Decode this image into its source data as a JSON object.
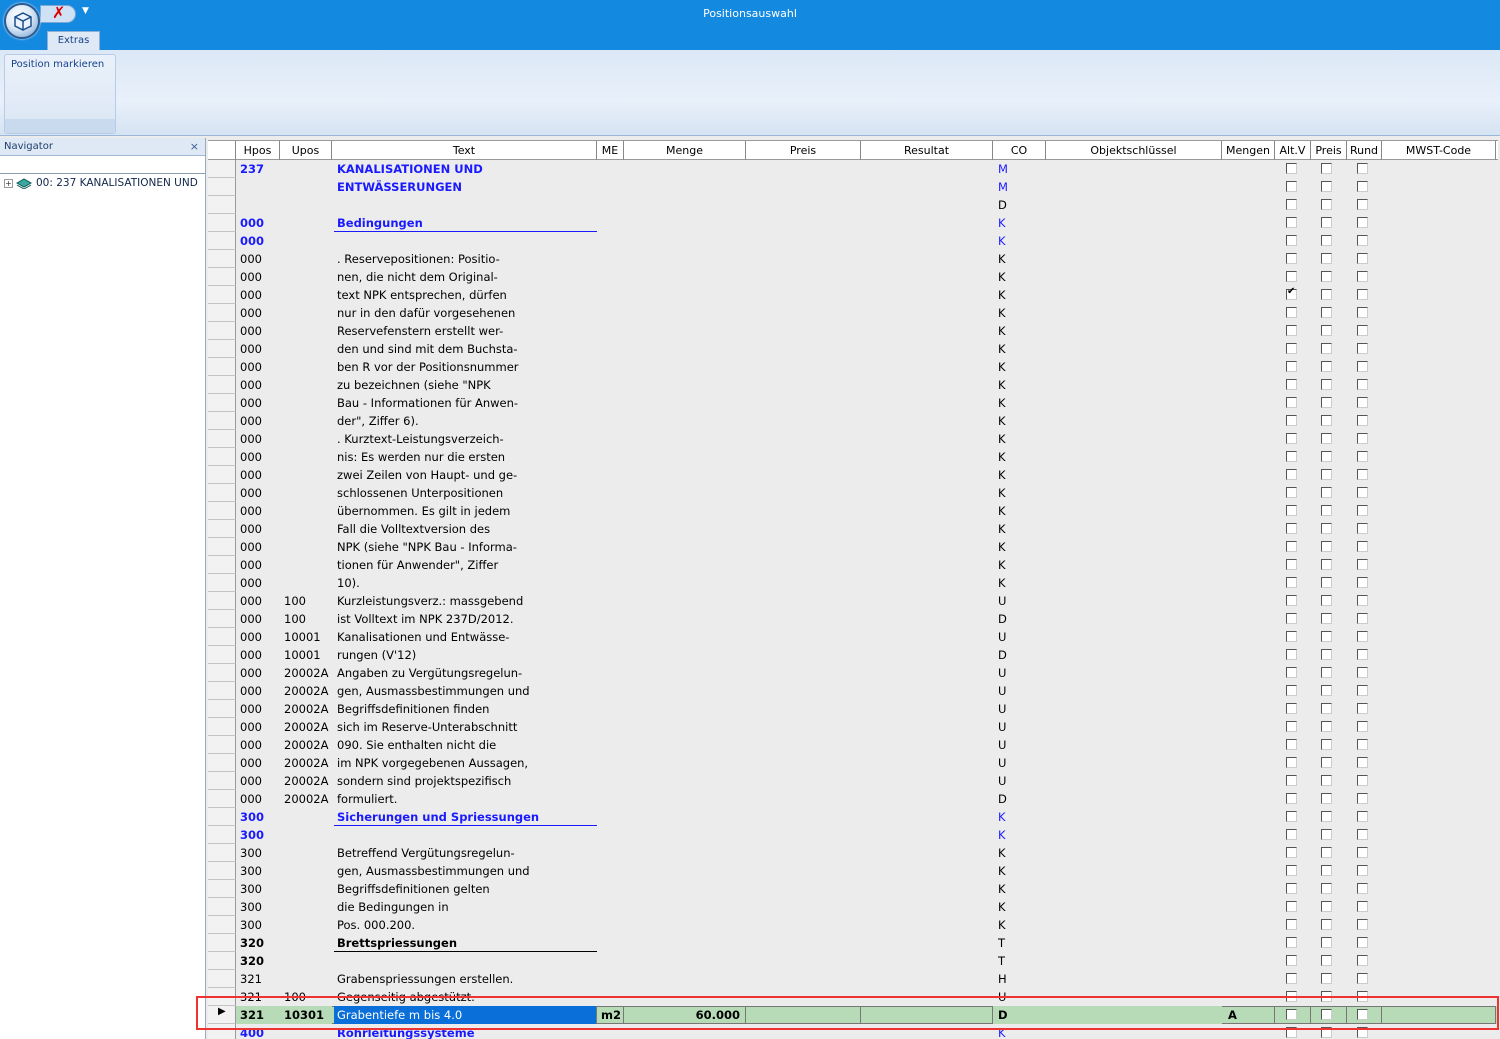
{
  "window": {
    "title": "Positionsauswahl"
  },
  "ribbon": {
    "tab": "Extras",
    "button": "Position markieren"
  },
  "navigator": {
    "title": "Navigator",
    "close": "×",
    "search_value": "",
    "tree_item": "00: 237 KANALISATIONEN UND"
  },
  "grid": {
    "columns": [
      "Hpos",
      "Upos",
      "Text",
      "ME",
      "Menge",
      "Preis",
      "Resultat",
      "CO",
      "Objektschlüssel",
      "Mengen",
      "Alt.V",
      "Preis",
      "Rund",
      "MWST-Code"
    ],
    "rows": [
      {
        "hpos": "237",
        "upos": "",
        "text": "KANALISATIONEN UND",
        "co": "M",
        "style": "h1",
        "alt": false
      },
      {
        "hpos": "",
        "upos": "",
        "text": "ENTWÄSSERUNGEN",
        "co": "M",
        "style": "h1",
        "alt": false
      },
      {
        "hpos": "",
        "upos": "",
        "text": "",
        "co": "D",
        "style": "n",
        "alt": false
      },
      {
        "hpos": "000",
        "upos": "",
        "text": "Bedingungen",
        "co": "K",
        "style": "h1u",
        "alt": false
      },
      {
        "hpos": "000",
        "upos": "",
        "text": "",
        "co": "K",
        "style": "hb",
        "alt": false
      },
      {
        "hpos": "000",
        "upos": "",
        "text": ". Reservepositionen: Positio-",
        "co": "K",
        "style": "n",
        "alt": false
      },
      {
        "hpos": "000",
        "upos": "",
        "text": "nen, die nicht dem Original-",
        "co": "K",
        "style": "n",
        "alt": false
      },
      {
        "hpos": "000",
        "upos": "",
        "text": "text NPK entsprechen, dürfen",
        "co": "K",
        "style": "n",
        "alt": true
      },
      {
        "hpos": "000",
        "upos": "",
        "text": "nur in den dafür vorgesehenen",
        "co": "K",
        "style": "n",
        "alt": false
      },
      {
        "hpos": "000",
        "upos": "",
        "text": "Reservefenstern erstellt wer-",
        "co": "K",
        "style": "n",
        "alt": false
      },
      {
        "hpos": "000",
        "upos": "",
        "text": "den und sind mit dem Buchsta-",
        "co": "K",
        "style": "n",
        "alt": false
      },
      {
        "hpos": "000",
        "upos": "",
        "text": "ben R vor der Positionsnummer",
        "co": "K",
        "style": "n",
        "alt": false
      },
      {
        "hpos": "000",
        "upos": "",
        "text": "zu bezeichnen (siehe \"NPK",
        "co": "K",
        "style": "n",
        "alt": false
      },
      {
        "hpos": "000",
        "upos": "",
        "text": "Bau - Informationen für Anwen-",
        "co": "K",
        "style": "n",
        "alt": false
      },
      {
        "hpos": "000",
        "upos": "",
        "text": "der\", Ziffer 6).",
        "co": "K",
        "style": "n",
        "alt": false
      },
      {
        "hpos": "000",
        "upos": "",
        "text": ". Kurztext-Leistungsverzeich-",
        "co": "K",
        "style": "n",
        "alt": false
      },
      {
        "hpos": "000",
        "upos": "",
        "text": "nis: Es werden nur die ersten",
        "co": "K",
        "style": "n",
        "alt": false
      },
      {
        "hpos": "000",
        "upos": "",
        "text": "zwei Zeilen von Haupt- und ge-",
        "co": "K",
        "style": "n",
        "alt": false
      },
      {
        "hpos": "000",
        "upos": "",
        "text": "schlossenen Unterpositionen",
        "co": "K",
        "style": "n",
        "alt": false
      },
      {
        "hpos": "000",
        "upos": "",
        "text": "übernommen. Es gilt in jedem",
        "co": "K",
        "style": "n",
        "alt": false
      },
      {
        "hpos": "000",
        "upos": "",
        "text": "Fall die Volltextversion des",
        "co": "K",
        "style": "n",
        "alt": false
      },
      {
        "hpos": "000",
        "upos": "",
        "text": "NPK (siehe \"NPK Bau - Informa-",
        "co": "K",
        "style": "n",
        "alt": false
      },
      {
        "hpos": "000",
        "upos": "",
        "text": "tionen für Anwender\", Ziffer",
        "co": "K",
        "style": "n",
        "alt": false
      },
      {
        "hpos": "000",
        "upos": "",
        "text": "10).",
        "co": "K",
        "style": "n",
        "alt": false
      },
      {
        "hpos": "000",
        "upos": "100",
        "text": "Kurzleistungsverz.: massgebend",
        "co": "U",
        "style": "n",
        "alt": false
      },
      {
        "hpos": "000",
        "upos": "100",
        "text": "ist Volltext im NPK 237D/2012.",
        "co": "D",
        "style": "n",
        "alt": false
      },
      {
        "hpos": "000",
        "upos": "10001",
        "text": "Kanalisationen und Entwässe-",
        "co": "U",
        "style": "n",
        "alt": false
      },
      {
        "hpos": "000",
        "upos": "10001",
        "text": "rungen (V'12)",
        "co": "D",
        "style": "n",
        "alt": false
      },
      {
        "hpos": "000",
        "upos": "20002A",
        "text": "Angaben zu Vergütungsregelun-",
        "co": "U",
        "style": "n",
        "alt": false
      },
      {
        "hpos": "000",
        "upos": "20002A",
        "text": "gen, Ausmassbestimmungen und",
        "co": "U",
        "style": "n",
        "alt": false
      },
      {
        "hpos": "000",
        "upos": "20002A",
        "text": "Begriffsdefinitionen finden",
        "co": "U",
        "style": "n",
        "alt": false
      },
      {
        "hpos": "000",
        "upos": "20002A",
        "text": "sich im Reserve-Unterabschnitt",
        "co": "U",
        "style": "n",
        "alt": false
      },
      {
        "hpos": "000",
        "upos": "20002A",
        "text": "090. Sie enthalten nicht die",
        "co": "U",
        "style": "n",
        "alt": false
      },
      {
        "hpos": "000",
        "upos": "20002A",
        "text": "im NPK vorgegebenen Aussagen,",
        "co": "U",
        "style": "n",
        "alt": false
      },
      {
        "hpos": "000",
        "upos": "20002A",
        "text": "sondern sind projektspezifisch",
        "co": "U",
        "style": "n",
        "alt": false
      },
      {
        "hpos": "000",
        "upos": "20002A",
        "text": "formuliert.",
        "co": "D",
        "style": "n",
        "alt": false
      },
      {
        "hpos": "300",
        "upos": "",
        "text": "Sicherungen und Spriessungen",
        "co": "K",
        "style": "h1u",
        "alt": false
      },
      {
        "hpos": "300",
        "upos": "",
        "text": "",
        "co": "K",
        "style": "hb",
        "alt": false
      },
      {
        "hpos": "300",
        "upos": "",
        "text": "Betreffend Vergütungsregelun-",
        "co": "K",
        "style": "n",
        "alt": false
      },
      {
        "hpos": "300",
        "upos": "",
        "text": "gen, Ausmassbestimmungen und",
        "co": "K",
        "style": "n",
        "alt": false
      },
      {
        "hpos": "300",
        "upos": "",
        "text": "Begriffsdefinitionen gelten",
        "co": "K",
        "style": "n",
        "alt": false
      },
      {
        "hpos": "300",
        "upos": "",
        "text": "die Bedingungen in",
        "co": "K",
        "style": "n",
        "alt": false
      },
      {
        "hpos": "300",
        "upos": "",
        "text": "Pos. 000.200.",
        "co": "K",
        "style": "n",
        "alt": false
      },
      {
        "hpos": "320",
        "upos": "",
        "text": "Brettspriessungen",
        "co": "T",
        "style": "h2u",
        "alt": false
      },
      {
        "hpos": "320",
        "upos": "",
        "text": "",
        "co": "T",
        "style": "h2b",
        "alt": false
      },
      {
        "hpos": "321",
        "upos": "",
        "text": "Grabenspriessungen erstellen.",
        "co": "H",
        "style": "n",
        "alt": false
      },
      {
        "hpos": "321",
        "upos": "100",
        "text": "Gegenseitig abgestützt.",
        "co": "U",
        "style": "strike",
        "alt": false
      },
      {
        "hpos": "321",
        "upos": "10301",
        "text": "Grabentiefe m bis 4.0",
        "me": "m2",
        "menge": "60.000",
        "co": "D",
        "mengen": "A",
        "style": "selected",
        "alt": false
      },
      {
        "hpos": "400",
        "upos": "",
        "text": "Rohrleitungssysteme",
        "co": "K",
        "style": "h1",
        "alt": false
      }
    ]
  }
}
